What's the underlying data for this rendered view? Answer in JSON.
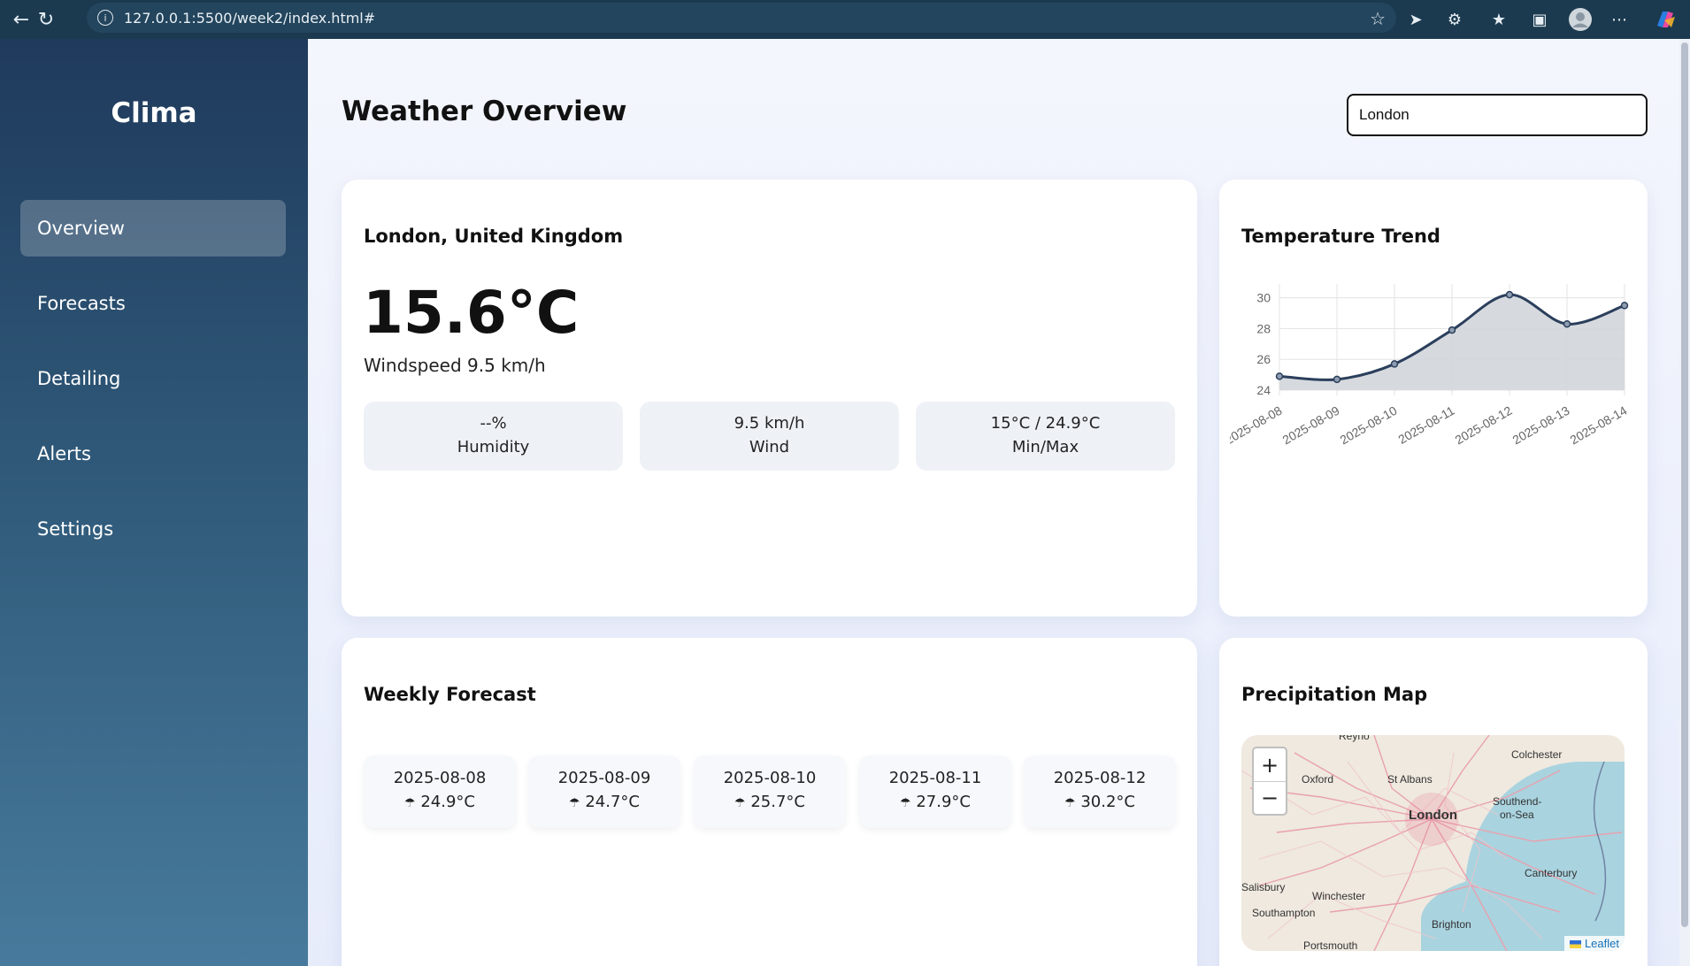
{
  "browser": {
    "url": "127.0.0.1:5500/week2/index.html#",
    "info_glyph": "i"
  },
  "sidebar": {
    "brand": "Clima",
    "items": [
      {
        "label": "Overview",
        "active": true
      },
      {
        "label": "Forecasts",
        "active": false
      },
      {
        "label": "Detailing",
        "active": false
      },
      {
        "label": "Alerts",
        "active": false
      },
      {
        "label": "Settings",
        "active": false
      }
    ]
  },
  "header": {
    "title": "Weather Overview",
    "search_value": "London"
  },
  "current": {
    "location": "London, United Kingdom",
    "temperature": "15.6°C",
    "windspeed_line": "Windspeed 9.5 km/h",
    "stats": [
      {
        "value": "--%",
        "label": "Humidity"
      },
      {
        "value": "9.5 km/h",
        "label": "Wind"
      },
      {
        "value": "15°C / 24.9°C",
        "label": "Min/Max"
      }
    ]
  },
  "trend": {
    "title": "Temperature Trend"
  },
  "chart_data": {
    "type": "area",
    "title": "Temperature Trend",
    "x": [
      "2025-08-08",
      "2025-08-09",
      "2025-08-10",
      "2025-08-11",
      "2025-08-12",
      "2025-08-13",
      "2025-08-14"
    ],
    "series": [
      {
        "values": [
          24.9,
          24.7,
          25.7,
          27.9,
          30.2,
          28.3,
          29.5
        ]
      }
    ],
    "ylim": [
      24,
      30.9
    ],
    "yticks": [
      24,
      26,
      28,
      30
    ],
    "grid": true,
    "line_color": "#2b3f5c",
    "fill_color": "#d2d6dc"
  },
  "weekly": {
    "title": "Weekly Forecast",
    "icon": "cloud-rain-icon",
    "glyph": "☂",
    "days": [
      {
        "date": "2025-08-08",
        "temp": "24.9°C"
      },
      {
        "date": "2025-08-09",
        "temp": "24.7°C"
      },
      {
        "date": "2025-08-10",
        "temp": "25.7°C"
      },
      {
        "date": "2025-08-11",
        "temp": "27.9°C"
      },
      {
        "date": "2025-08-12",
        "temp": "30.2°C"
      }
    ]
  },
  "map": {
    "title": "Precipitation Map",
    "zoom_in": "+",
    "zoom_out": "−",
    "attribution": "Leaflet",
    "labels": {
      "reynolds": "Reyno",
      "colchester": "Colchester",
      "oxford": "Oxford",
      "st_albans": "St Albans",
      "london": "London",
      "southend_1": "Southend-",
      "southend_2": "on-Sea",
      "canterbury": "Canterbury",
      "salisbury": "Salisbury",
      "winchester": "Winchester",
      "southampton": "Southampton",
      "brighton": "Brighton",
      "portsmouth": "Portsmouth"
    }
  }
}
